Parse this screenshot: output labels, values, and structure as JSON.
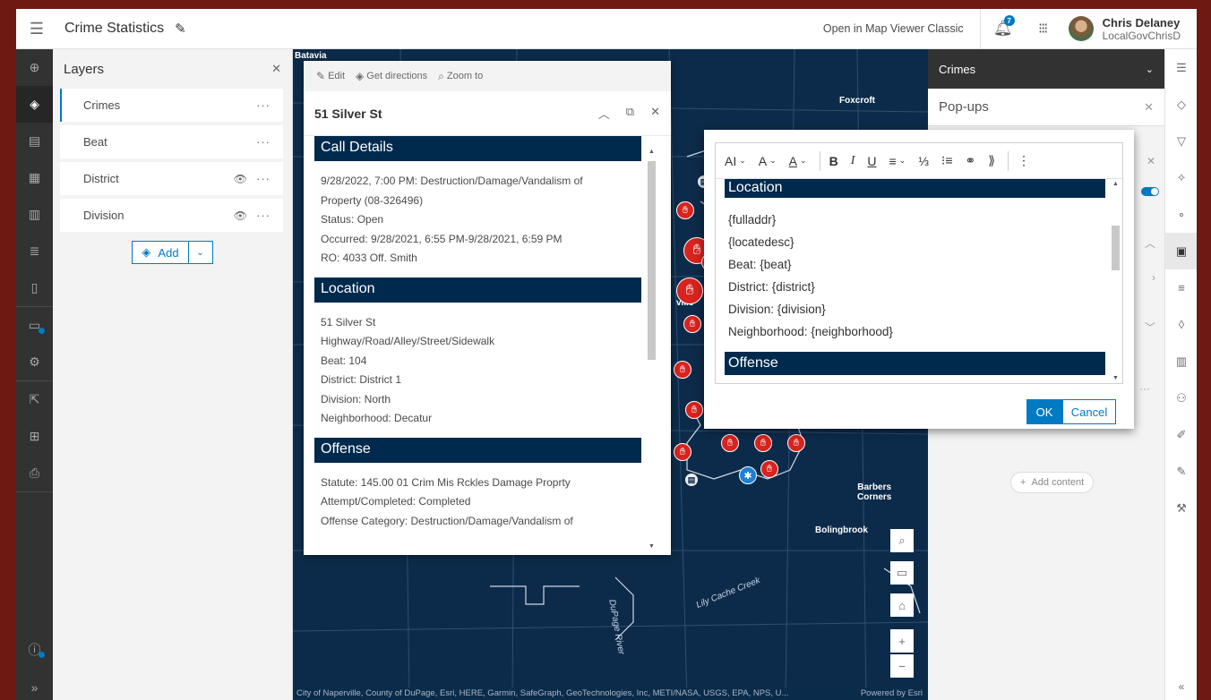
{
  "header": {
    "title": "Crime Statistics",
    "open_classic": "Open in Map Viewer Classic",
    "notification_count": "7",
    "user_name": "Chris Delaney",
    "user_handle": "LocalGovChrisD"
  },
  "layers_panel": {
    "title": "Layers",
    "items": [
      {
        "label": "Crimes"
      },
      {
        "label": "Beat"
      },
      {
        "label": "District"
      },
      {
        "label": "Division"
      }
    ],
    "add_label": "Add"
  },
  "map": {
    "labels": {
      "batavia": "Batavia",
      "foxcroft": "Foxcroft",
      "barbers": "Barbers",
      "corners": "Corners",
      "bolingbrook": "Bolingbrook",
      "lily_cache": "Lily Cache Creek",
      "dupage_river": "DuPage River",
      "ville": "ville"
    },
    "attribution": "City of Naperville, County of DuPage, Esri, HERE, Garmin, SafeGraph, GeoTechnologies, Inc, METI/NASA, USGS, EPA, NPS, U...",
    "powered_by": "Powered by Esri"
  },
  "popup": {
    "actions": {
      "edit": "Edit",
      "directions": "Get directions",
      "zoom": "Zoom to"
    },
    "title": "51 Silver St",
    "sections": [
      {
        "heading": "Call Details",
        "lines": [
          "9/28/2022, 7:00 PM: Destruction/Damage/Vandalism of",
          "Property (08-326496)",
          "Status: Open",
          "Occurred: 9/28/2021, 6:55 PM-9/28/2021, 6:59 PM",
          "RO: 4033 Off. Smith"
        ]
      },
      {
        "heading": "Location",
        "lines": [
          "51 Silver St",
          "Highway/Road/Alley/Street/Sidewalk",
          "Beat: 104",
          "District: District 1",
          "Division: North",
          "Neighborhood: Decatur"
        ]
      },
      {
        "heading": "Offense",
        "lines": [
          "Statute: 145.00 01 Crim Mis Rckles Damage Proprty",
          "Attempt/Completed: Completed",
          "Offense Category: Destruction/Damage/Vandalism of"
        ]
      }
    ]
  },
  "right_panel": {
    "layer_select": "Crimes",
    "subtitle": "Pop-ups",
    "add_content": "Add content"
  },
  "editor": {
    "toolbar": {
      "font_size": "AI",
      "font_style": "A",
      "font_color": "A",
      "bold": "B",
      "italic": "I",
      "underline": "U"
    },
    "sections": [
      {
        "heading": "Location",
        "lines": [
          "{fulladdr}",
          "{locatedesc}",
          "Beat: {beat}",
          "District: {district}",
          "Division: {division}",
          "Neighborhood: {neighborhood}"
        ]
      },
      {
        "heading": "Offense",
        "lines": []
      }
    ],
    "ok_label": "OK",
    "cancel_label": "Cancel"
  }
}
